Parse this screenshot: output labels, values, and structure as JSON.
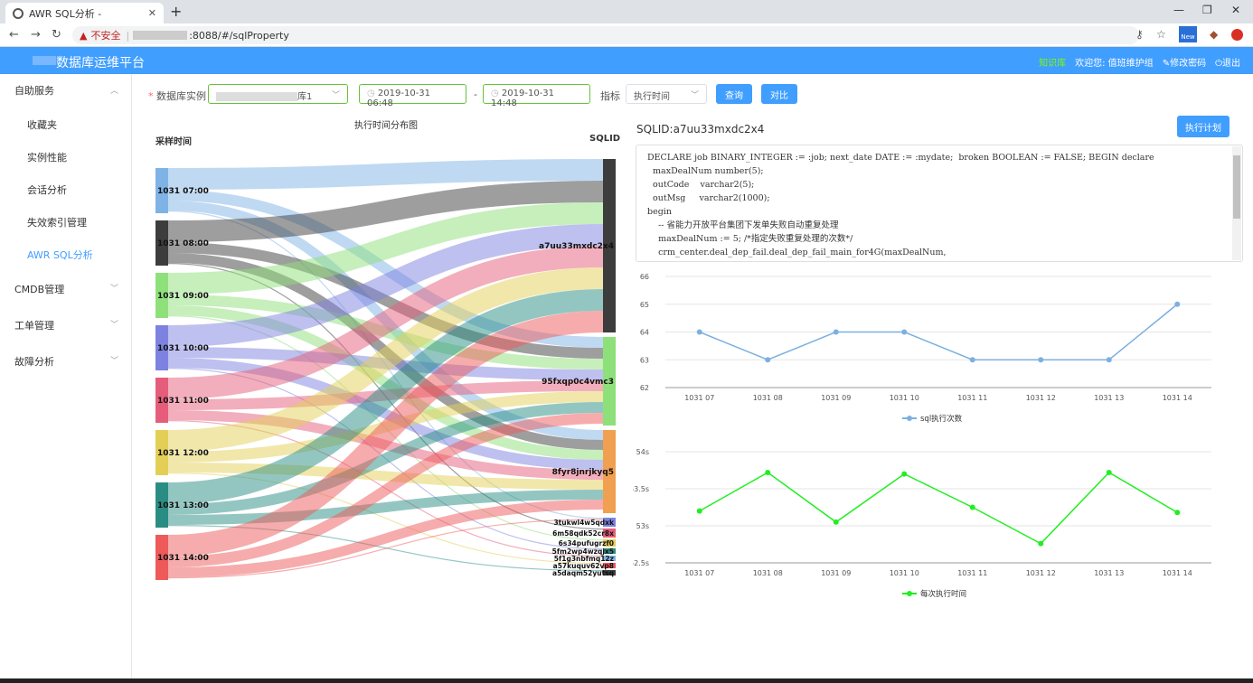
{
  "browser": {
    "tab_title": "AWR SQL分析 - ",
    "url_insecure": "不安全",
    "url_path": ":8088/#/sqlProperty",
    "ext_label": "New"
  },
  "header": {
    "brand": "数据库运维平台",
    "online": "知识库",
    "welcome": "欢迎您: 值班维护组",
    "change_pwd": "修改密码",
    "logout": "退出"
  },
  "sidebar": {
    "groups": [
      {
        "label": "自助服务",
        "items": [
          "收藏夹",
          "实例性能",
          "会话分析",
          "失效索引管理",
          "AWR SQL分析"
        ]
      },
      {
        "label": "CMDB管理"
      },
      {
        "label": "工单管理"
      },
      {
        "label": "故障分析"
      }
    ],
    "active": "AWR SQL分析"
  },
  "filters": {
    "instance_label": "数据库实例",
    "instance_value": "库1",
    "start": "2019-10-31 06:48",
    "dash": "-",
    "end": "2019-10-31 14:48",
    "metric_label": "指标",
    "metric_value": "执行时间",
    "query_btn": "查询",
    "compare_btn": "对比"
  },
  "sankey": {
    "title": "执行时间分布图",
    "left_head": "采样时间",
    "right_head": "SQLID",
    "sources": [
      {
        "label": "1031 07:00",
        "color": "#7fb3e6"
      },
      {
        "label": "1031 08:00",
        "color": "#3d3d3d"
      },
      {
        "label": "1031 09:00",
        "color": "#8ee07a"
      },
      {
        "label": "1031 10:00",
        "color": "#7d82e0"
      },
      {
        "label": "1031 11:00",
        "color": "#e55d7a"
      },
      {
        "label": "1031 12:00",
        "color": "#e3cf55"
      },
      {
        "label": "1031 13:00",
        "color": "#2a8d84"
      },
      {
        "label": "1031 14:00",
        "color": "#ee5a5a"
      }
    ],
    "targets": [
      {
        "label": "a7uu33mxdc2x4",
        "color": "#3d3d3d"
      },
      {
        "label": "95fxqp0c4vmc3",
        "color": "#8ee07a"
      },
      {
        "label": "8fyr8jnrjkyq5",
        "color": "#f0a050"
      },
      {
        "label": "3tukwl4w5qdxk",
        "color": "#7d82e0"
      },
      {
        "label": "6m58qdk52cr8x",
        "color": "#e55d7a"
      },
      {
        "label": "6s34pufugrzf0",
        "color": "#e3cf55"
      },
      {
        "label": "5fm2wp4wzqjx5",
        "color": "#2a8d84"
      },
      {
        "label": "5f1g3nbfmq12z",
        "color": "#7fb3e6"
      },
      {
        "label": "a57kuquv62vp8",
        "color": "#ee5a5a"
      },
      {
        "label": "a5daqm52yutsq",
        "color": "#3d3d3d"
      }
    ]
  },
  "sql": {
    "sqlid": "SQLID:a7uu33mxdc2x4",
    "plan_btn": "执行计划",
    "lines": [
      "DECLARE job BINARY_INTEGER := :job; next_date DATE := :mydate;  broken BOOLEAN := FALSE; BEGIN declare",
      "  maxDealNum number(5);",
      "  outCode    varchar2(5);",
      "  outMsg     varchar2(1000);",
      "begin",
      "    -- 省能力开放平台集团下发单失败自动重复处理",
      "    maxDealNum := 5; /*指定失败重复处理的次数*/",
      "    crm_center.deal_dep_fail.deal_dep_fail_main_for4G(maxDealNum,"
    ]
  },
  "chart_data": [
    {
      "type": "line",
      "categories": [
        "1031 07",
        "1031 08",
        "1031 09",
        "1031 10",
        "1031 11",
        "1031 12",
        "1031 13",
        "1031 14"
      ],
      "series": [
        {
          "name": "sql执行次数",
          "values": [
            64,
            63,
            64,
            64,
            63,
            63,
            63,
            65
          ],
          "color": "#7cb0e0"
        }
      ],
      "ylim": [
        62,
        66
      ],
      "yticks": [
        "62",
        "63",
        "64",
        "65",
        "66"
      ]
    },
    {
      "type": "line",
      "categories": [
        "1031 07",
        "1031 08",
        "1031 09",
        "1031 10",
        "1031 11",
        "1031 12",
        "1031 13",
        "1031 14"
      ],
      "series": [
        {
          "name": "每次执行时间",
          "values": [
            53.2,
            53.72,
            53.05,
            53.7,
            53.25,
            52.76,
            53.72,
            53.18
          ],
          "color": "#22ee22"
        }
      ],
      "ylim": [
        52.5,
        54
      ],
      "yticks": [
        "52.5s",
        "53s",
        "53.5s",
        "54s"
      ]
    }
  ]
}
